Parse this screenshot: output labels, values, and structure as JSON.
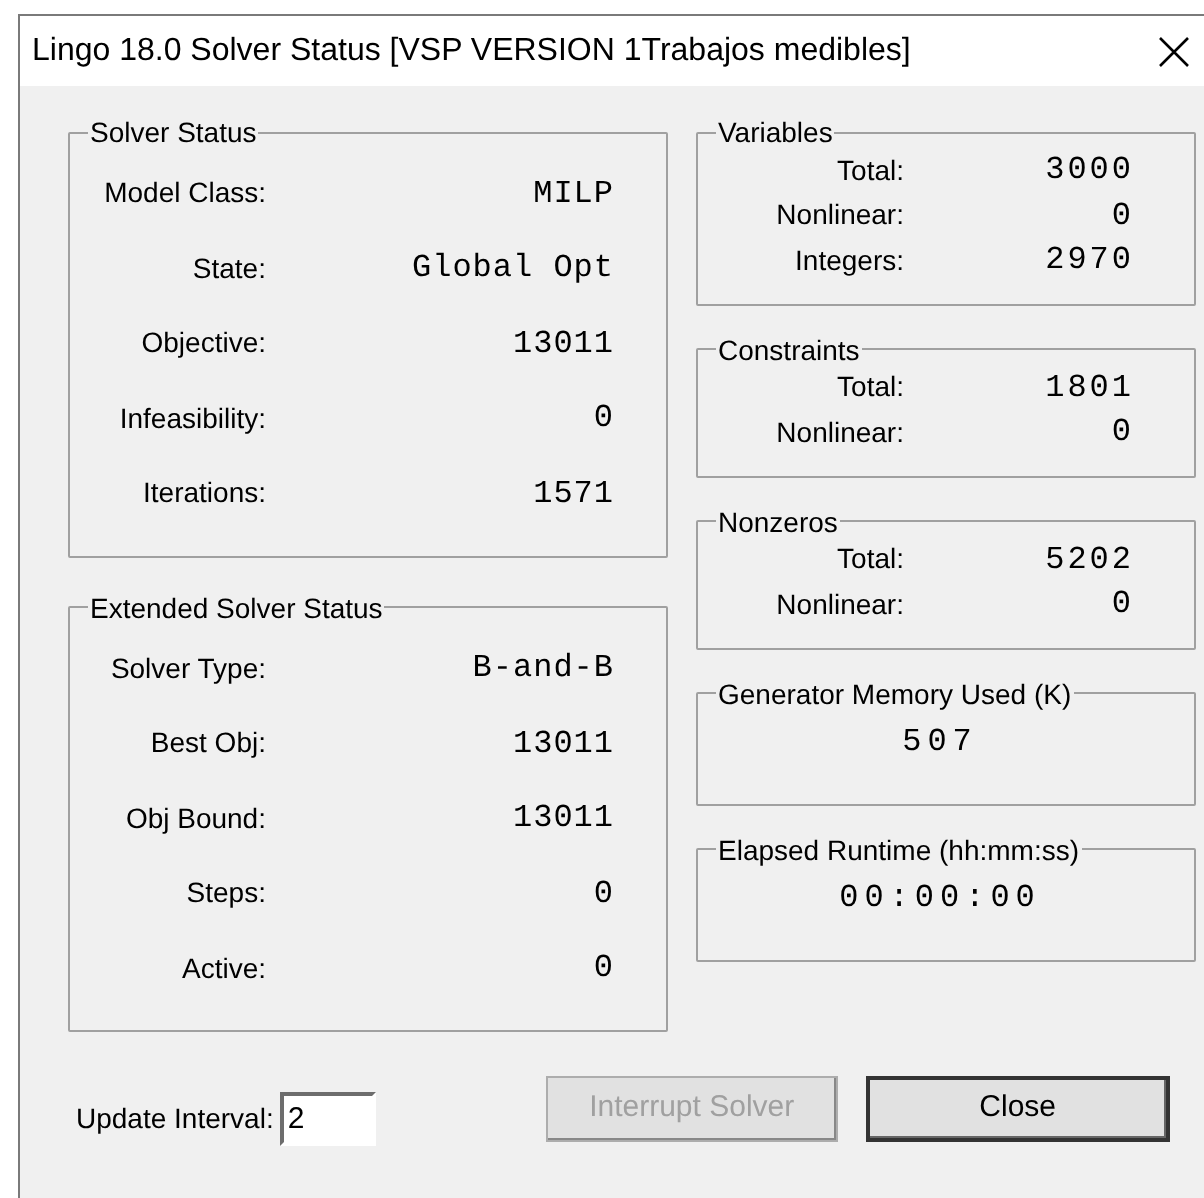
{
  "window": {
    "title": "Lingo 18.0 Solver Status [VSP VERSION 1Trabajos medibles]"
  },
  "left_groups": [
    {
      "title": "Solver Status",
      "rows": [
        {
          "label": "Model Class:",
          "value": "MILP"
        },
        {
          "label": "State:",
          "value": "Global Opt"
        },
        {
          "label": "Objective:",
          "value": "13011"
        },
        {
          "label": "Infeasibility:",
          "value": "0"
        },
        {
          "label": "Iterations:",
          "value": "1571"
        }
      ]
    },
    {
      "title": "Extended Solver Status",
      "rows": [
        {
          "label": "Solver Type:",
          "value": "B-and-B"
        },
        {
          "label": "Best Obj:",
          "value": "13011"
        },
        {
          "label": "Obj Bound:",
          "value": "13011"
        },
        {
          "label": "Steps:",
          "value": "0"
        },
        {
          "label": "Active:",
          "value": "0"
        }
      ]
    }
  ],
  "right_groups": [
    {
      "kind": "rows",
      "title": "Variables",
      "rows": [
        {
          "label": "Total:",
          "value": "3000"
        },
        {
          "label": "Nonlinear:",
          "value": "0"
        },
        {
          "label": "Integers:",
          "value": "2970"
        }
      ]
    },
    {
      "kind": "rows",
      "title": "Constraints",
      "rows": [
        {
          "label": "Total:",
          "value": "1801"
        },
        {
          "label": "Nonlinear:",
          "value": "0"
        }
      ]
    },
    {
      "kind": "rows",
      "title": "Nonzeros",
      "rows": [
        {
          "label": "Total:",
          "value": "5202"
        },
        {
          "label": "Nonlinear:",
          "value": "0"
        }
      ]
    },
    {
      "kind": "single",
      "title": "Generator Memory Used (K)",
      "value": "507"
    },
    {
      "kind": "single",
      "title": "Elapsed Runtime (hh:mm:ss)",
      "value": "00:00:00"
    }
  ],
  "update_interval": {
    "label": "Update Interval:",
    "value": "2"
  },
  "buttons": [
    {
      "label": "Interrupt Solver",
      "disabled": true,
      "default": false
    },
    {
      "label": "Close",
      "disabled": false,
      "default": true
    }
  ]
}
